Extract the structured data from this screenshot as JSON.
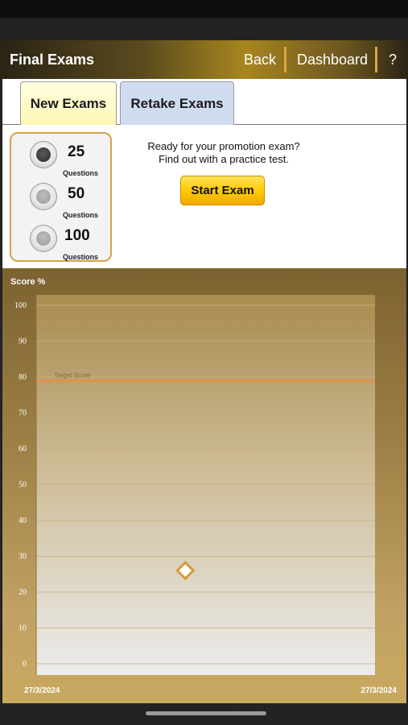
{
  "header": {
    "title": "Final Exams",
    "back_label": "Back",
    "dashboard_label": "Dashboard",
    "help_label": "?"
  },
  "tabs": [
    {
      "label": "New Exams",
      "active": true
    },
    {
      "label": "Retake Exams",
      "active": false
    }
  ],
  "question_options": [
    {
      "count": "25",
      "label": "Questions",
      "selected": true
    },
    {
      "count": "50",
      "label": "Questions",
      "selected": false
    },
    {
      "count": "100",
      "label": "Questions",
      "selected": false
    }
  ],
  "promo": {
    "line1": "Ready for your promotion exam?",
    "line2": "Find out with a practice test.",
    "start_label": "Start Exam"
  },
  "colors": {
    "accent_gold": "#d9a640",
    "target_line": "#f0883a",
    "button_yellow": "#ffc800"
  },
  "chart_data": {
    "type": "scatter",
    "ylabel": "Score %",
    "ylim": [
      0,
      100
    ],
    "yticks": [
      "100",
      "90",
      "80",
      "70",
      "60",
      "50",
      "40",
      "30",
      "20",
      "10",
      "0"
    ],
    "x_start_label": "27/3/2024",
    "x_end_label": "27/3/2024",
    "target": {
      "label": "Target Score",
      "value": 79
    },
    "points": [
      {
        "x": 0.44,
        "y": 26
      }
    ]
  }
}
